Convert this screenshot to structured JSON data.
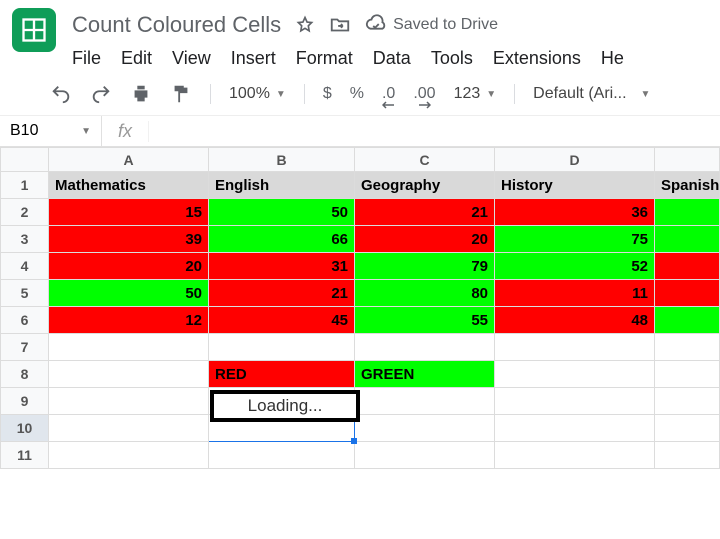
{
  "doc": {
    "title": "Count Coloured Cells",
    "saved_label": "Saved to Drive"
  },
  "menus": [
    "File",
    "Edit",
    "View",
    "Insert",
    "Format",
    "Data",
    "Tools",
    "Extensions",
    "He"
  ],
  "toolbar": {
    "zoom": "100%",
    "currency": "$",
    "percent": "%",
    "dec_dec": ".0",
    "dec_inc": ".00",
    "numfmt": "123",
    "font": "Default (Ari..."
  },
  "namebox": "B10",
  "columns": [
    "A",
    "B",
    "C",
    "D",
    ""
  ],
  "rows": [
    "1",
    "2",
    "3",
    "4",
    "5",
    "6",
    "7",
    "8",
    "9",
    "10",
    "11"
  ],
  "cells": {
    "r1": [
      {
        "v": "Mathematics",
        "cls": "hdr",
        "align": "left"
      },
      {
        "v": "English",
        "cls": "hdr",
        "align": "left"
      },
      {
        "v": "Geography",
        "cls": "hdr",
        "align": "left"
      },
      {
        "v": "History",
        "cls": "hdr",
        "align": "left"
      },
      {
        "v": "Spanish",
        "cls": "hdr",
        "align": "left"
      }
    ],
    "r2": [
      {
        "v": "15",
        "cls": "red"
      },
      {
        "v": "50",
        "cls": "green"
      },
      {
        "v": "21",
        "cls": "red"
      },
      {
        "v": "36",
        "cls": "red"
      },
      {
        "v": "",
        "cls": "green"
      }
    ],
    "r3": [
      {
        "v": "39",
        "cls": "red"
      },
      {
        "v": "66",
        "cls": "green"
      },
      {
        "v": "20",
        "cls": "red"
      },
      {
        "v": "75",
        "cls": "green"
      },
      {
        "v": "",
        "cls": "green"
      }
    ],
    "r4": [
      {
        "v": "20",
        "cls": "red"
      },
      {
        "v": "31",
        "cls": "red"
      },
      {
        "v": "79",
        "cls": "green"
      },
      {
        "v": "52",
        "cls": "green"
      },
      {
        "v": "",
        "cls": "red"
      }
    ],
    "r5": [
      {
        "v": "50",
        "cls": "green"
      },
      {
        "v": "21",
        "cls": "red"
      },
      {
        "v": "80",
        "cls": "green"
      },
      {
        "v": "11",
        "cls": "red"
      },
      {
        "v": "",
        "cls": "red"
      }
    ],
    "r6": [
      {
        "v": "12",
        "cls": "red"
      },
      {
        "v": "45",
        "cls": "red"
      },
      {
        "v": "55",
        "cls": "green"
      },
      {
        "v": "48",
        "cls": "red"
      },
      {
        "v": "",
        "cls": "green"
      }
    ],
    "r7": [
      {
        "v": ""
      },
      {
        "v": ""
      },
      {
        "v": ""
      },
      {
        "v": ""
      },
      {
        "v": ""
      }
    ],
    "r8": [
      {
        "v": ""
      },
      {
        "v": "RED",
        "cls": "red",
        "align": "left"
      },
      {
        "v": "GREEN",
        "cls": "green",
        "align": "left"
      },
      {
        "v": ""
      },
      {
        "v": ""
      }
    ],
    "r9": [
      {
        "v": ""
      },
      {
        "v": ""
      },
      {
        "v": ""
      },
      {
        "v": ""
      },
      {
        "v": ""
      }
    ],
    "r10": [
      {
        "v": ""
      },
      {
        "v": "",
        "sel": true
      },
      {
        "v": ""
      },
      {
        "v": ""
      },
      {
        "v": ""
      }
    ],
    "r11": [
      {
        "v": ""
      },
      {
        "v": ""
      },
      {
        "v": ""
      },
      {
        "v": ""
      },
      {
        "v": ""
      }
    ]
  },
  "loading_label": "Loading..."
}
